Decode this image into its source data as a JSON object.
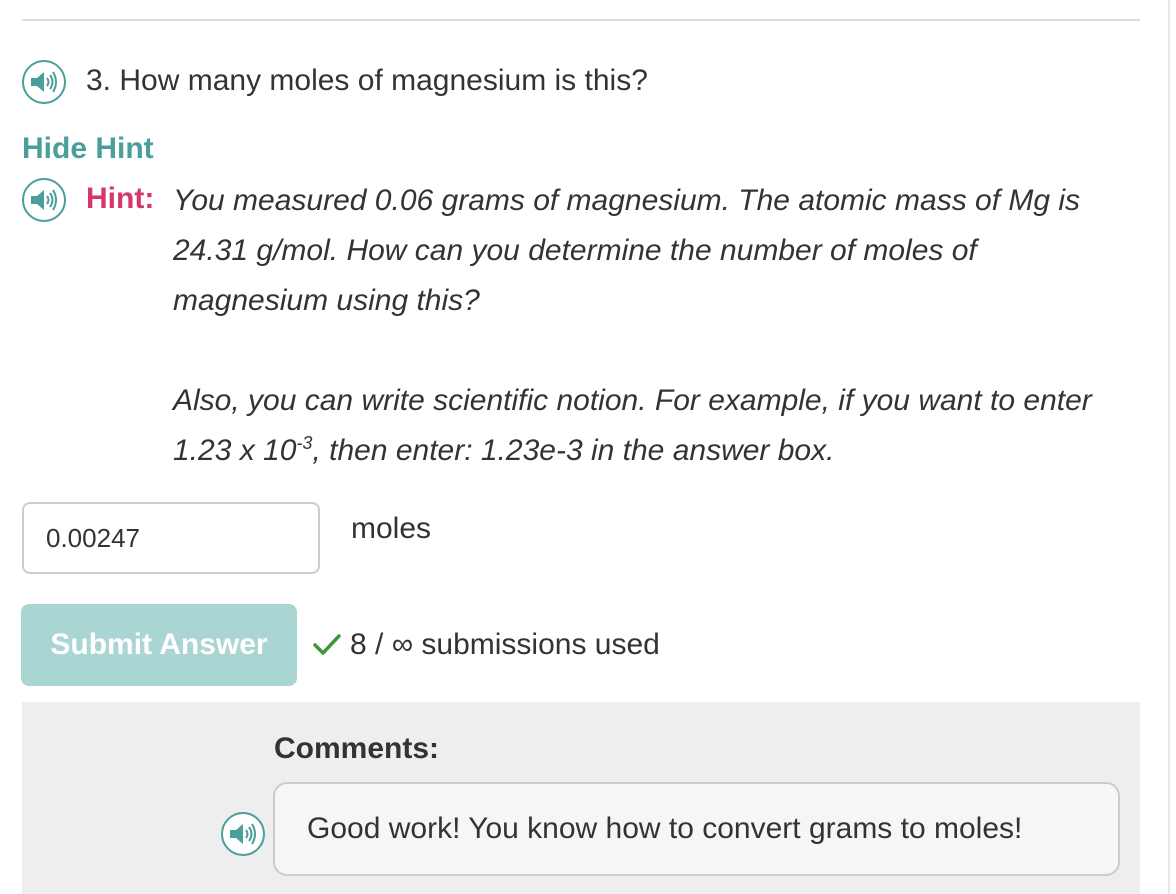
{
  "question": {
    "text": "3. How many moles of magnesium is this?"
  },
  "hint": {
    "toggle_label": "Hide Hint",
    "label": "Hint:",
    "paragraph1": "You measured 0.06 grams of magnesium. The atomic mass of Mg is 24.31 g/mol. How can you determine the number of moles of magnesium using this?",
    "paragraph2_before": "Also, you can write scientific notion. For example, if you want to enter 1.23 x 10",
    "paragraph2_sup": "-3",
    "paragraph2_after": ", then enter: 1.23e-3 in the answer box."
  },
  "answer": {
    "value": "0.00247",
    "unit": "moles"
  },
  "submit": {
    "label": "Submit Answer"
  },
  "submissions": {
    "text": "8 / ∞ submissions used"
  },
  "comments": {
    "label": "Comments:",
    "text": "Good work! You know how to convert grams to moles!"
  },
  "colors": {
    "accent": "#4a9e9b",
    "hint_label": "#d4376d",
    "submit_bg": "#a9d6d3",
    "check": "#3c9a3c",
    "comments_bg": "#eeeeee"
  },
  "icons": {
    "audio": "speaker-icon",
    "check": "check-icon"
  }
}
